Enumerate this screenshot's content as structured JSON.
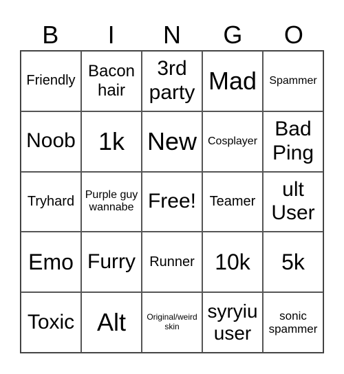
{
  "header": [
    "B",
    "I",
    "N",
    "G",
    "O"
  ],
  "cells": [
    {
      "text": "Friendly",
      "size": 20
    },
    {
      "text": "Bacon hair",
      "size": 24
    },
    {
      "text": "3rd party",
      "size": 30
    },
    {
      "text": "Mad",
      "size": 36
    },
    {
      "text": "Spammer",
      "size": 16
    },
    {
      "text": "Noob",
      "size": 30
    },
    {
      "text": "1k",
      "size": 36
    },
    {
      "text": "New",
      "size": 36
    },
    {
      "text": "Cosplayer",
      "size": 16
    },
    {
      "text": "Bad Ping",
      "size": 30
    },
    {
      "text": "Tryhard",
      "size": 20
    },
    {
      "text": "Purple guy wannabe",
      "size": 16
    },
    {
      "text": "Free!",
      "size": 30
    },
    {
      "text": "Teamer",
      "size": 20
    },
    {
      "text": "ult User",
      "size": 30
    },
    {
      "text": "Emo",
      "size": 32
    },
    {
      "text": "Furry",
      "size": 30
    },
    {
      "text": "Runner",
      "size": 20
    },
    {
      "text": "10k",
      "size": 32
    },
    {
      "text": "5k",
      "size": 32
    },
    {
      "text": "Toxic",
      "size": 30
    },
    {
      "text": "Alt",
      "size": 36
    },
    {
      "text": "Original/weird skin",
      "size": 12
    },
    {
      "text": "syryiu user",
      "size": 28
    },
    {
      "text": "sonic spammer",
      "size": 17
    }
  ]
}
